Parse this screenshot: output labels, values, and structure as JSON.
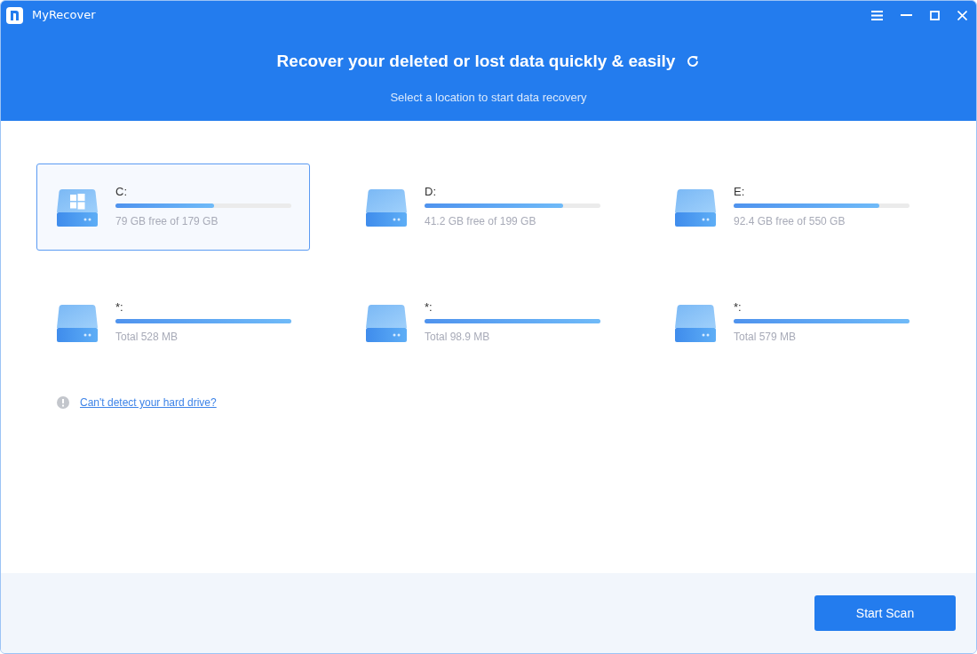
{
  "window": {
    "title": "MyRecover"
  },
  "header": {
    "title": "Recover your deleted or lost data quickly & easily",
    "subtitle": "Select a location to start data recovery"
  },
  "drives": [
    {
      "label": "C:",
      "kind": "system",
      "level": 0.56,
      "info": "79 GB free of 179 GB",
      "selected": true
    },
    {
      "label": "D:",
      "kind": "disk",
      "level": 0.79,
      "info": "41.2 GB free of 199 GB",
      "selected": false
    },
    {
      "label": "E:",
      "kind": "disk",
      "level": 0.83,
      "info": "92.4 GB free of 550 GB",
      "selected": false
    },
    {
      "label": "*:",
      "kind": "disk",
      "level": 1,
      "info": "Total 528 MB",
      "selected": false
    },
    {
      "label": "*:",
      "kind": "disk",
      "level": 1,
      "info": "Total 98.9 MB",
      "selected": false
    },
    {
      "label": "*:",
      "kind": "disk",
      "level": 1,
      "info": "Total 579 MB",
      "selected": false
    }
  ],
  "help_link": "Can't detect your hard drive?",
  "start_button": "Start Scan"
}
